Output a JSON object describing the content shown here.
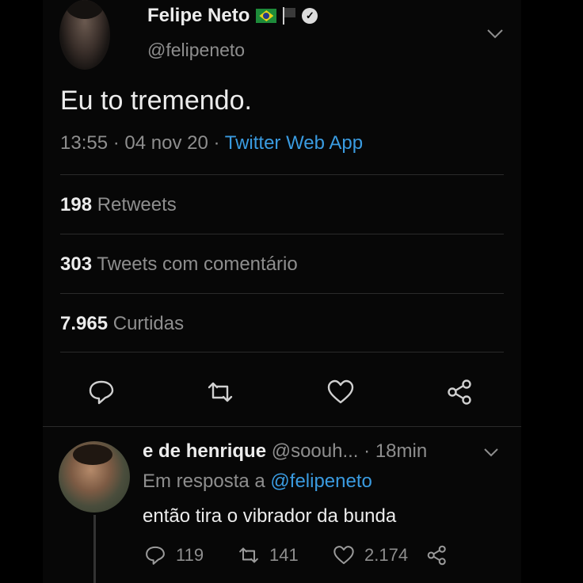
{
  "tweet": {
    "author_name": "Felipe Neto",
    "author_handle": "@felipeneto",
    "text": "Eu to tremendo.",
    "time": "13:55",
    "date": "04 nov 20",
    "separator": "·",
    "client": "Twitter Web App",
    "stats": [
      {
        "count": "198",
        "label": "Retweets"
      },
      {
        "count": "303",
        "label": "Tweets com comentário"
      },
      {
        "count": "7.965",
        "label": "Curtidas"
      }
    ],
    "icons": [
      "reply-icon",
      "retweet-icon",
      "like-icon",
      "share-icon"
    ]
  },
  "reply": {
    "author_name": "e de henrique",
    "author_handle": "@soouh...",
    "time": "· 18min",
    "in_reply_prefix": "Em resposta a",
    "in_reply_mention": "@felipeneto",
    "text": "então tira o vibrador da bunda",
    "replies": "119",
    "retweets": "141",
    "likes": "2.174"
  },
  "colors": {
    "background": "#000000",
    "text_primary": "#ececec",
    "text_secondary": "#8e8e8e",
    "link": "#3a9be0",
    "divider": "#2a2a2a"
  }
}
